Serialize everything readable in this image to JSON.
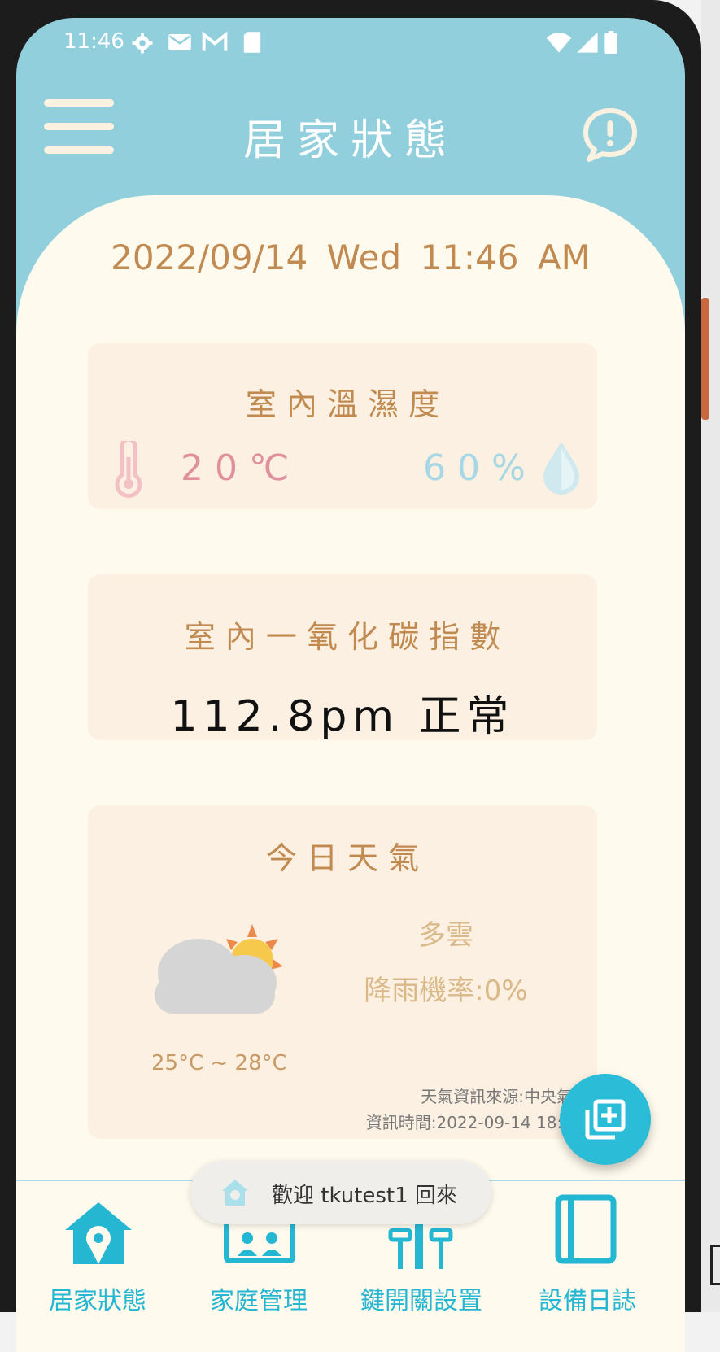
{
  "status_bar": {
    "time": "11:46"
  },
  "header": {
    "title": "居家狀態"
  },
  "datetime": "2022/09/14  Wed  11:46 AM",
  "temp_humidity_card": {
    "title": "室 內 溫 濕 度",
    "temperature": "20℃",
    "humidity": "60%"
  },
  "co_card": {
    "title": "室 內 一 氧 化 碳 指 數",
    "value": "112.8pm 正常"
  },
  "weather_card": {
    "title": "今 日 天 氣",
    "description": "多雲",
    "rain_chance": "降雨機率:0%",
    "temp_range": "25°C ~ 28°C",
    "source": "天氣資訊來源:中央氣",
    "info_time": "資訊時間:2022-09-14 18:0"
  },
  "toast": {
    "text": "歡迎 tkutest1 回來"
  },
  "bottom_nav": {
    "items": [
      {
        "label": "居家狀態",
        "icon": "home-location-icon"
      },
      {
        "label": "家庭管理",
        "icon": "family-icon"
      },
      {
        "label": "鍵開關設置",
        "icon": "switch-settings-icon"
      },
      {
        "label": "設備日誌",
        "icon": "notebook-icon"
      }
    ]
  },
  "colors": {
    "header_bg": "#91cfdc",
    "panel_bg": "#fefaee",
    "card_bg": "#fbf0e1",
    "accent": "#2bbcd8",
    "temp": "#e0909c",
    "humidity": "#a5d8e4"
  }
}
